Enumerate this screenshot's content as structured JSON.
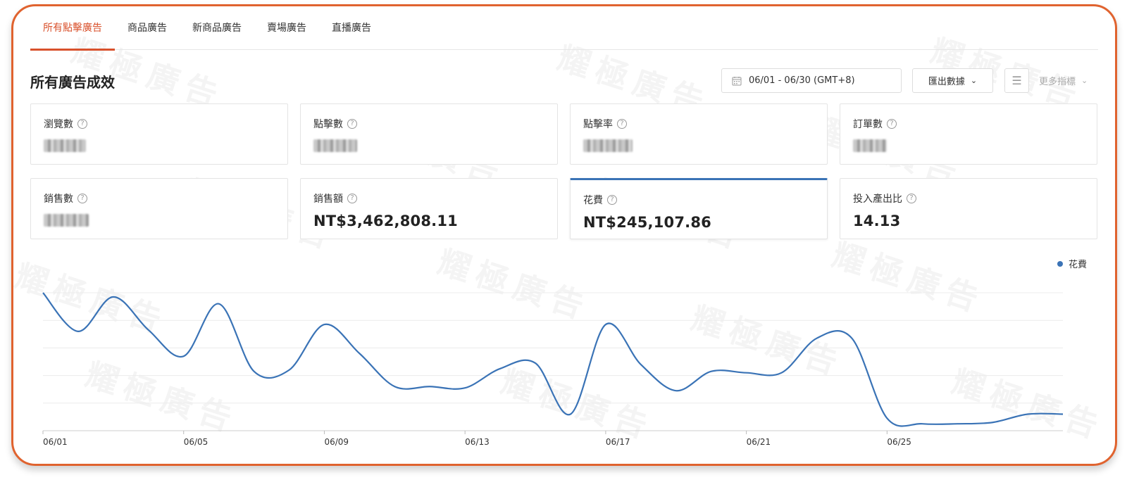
{
  "tabs": [
    {
      "label": "所有點擊廣告",
      "active": true
    },
    {
      "label": "商品廣告",
      "active": false
    },
    {
      "label": "新商品廣告",
      "active": false
    },
    {
      "label": "賣場廣告",
      "active": false
    },
    {
      "label": "直播廣告",
      "active": false
    }
  ],
  "section_title": "所有廣告成效",
  "toolbar": {
    "date_range": "06/01 - 06/30 (GMT+8)",
    "export_label": "匯出數據",
    "more_metrics_label": "更多指標"
  },
  "metrics": [
    {
      "label": "瀏覽數",
      "value": "",
      "hidden": true
    },
    {
      "label": "點擊數",
      "value": "",
      "hidden": true
    },
    {
      "label": "點擊率",
      "value": "",
      "hidden": true
    },
    {
      "label": "訂單數",
      "value": "",
      "hidden": true
    },
    {
      "label": "銷售數",
      "value": "",
      "hidden": true
    },
    {
      "label": "銷售額",
      "value": "NT$3,462,808.11",
      "hidden": false
    },
    {
      "label": "花費",
      "value": "NT$245,107.86",
      "hidden": false,
      "selected": true
    },
    {
      "label": "投入產出比",
      "value": "14.13",
      "hidden": false
    }
  ],
  "watermark_text": "耀極廣告",
  "colors": {
    "accent": "#d9512c",
    "frame": "#e0632f",
    "series": "#3a73b6"
  },
  "chart_data": {
    "type": "line",
    "legend": [
      "花費"
    ],
    "legend_position": "top-right",
    "grid": true,
    "x": [
      "06/01",
      "06/02",
      "06/03",
      "06/04",
      "06/05",
      "06/06",
      "06/07",
      "06/08",
      "06/09",
      "06/10",
      "06/11",
      "06/12",
      "06/13",
      "06/14",
      "06/15",
      "06/16",
      "06/17",
      "06/18",
      "06/19",
      "06/20",
      "06/21",
      "06/22",
      "06/23",
      "06/24",
      "06/25",
      "06/26",
      "06/27",
      "06/28",
      "06/29",
      "06/30"
    ],
    "x_ticks": [
      "06/01",
      "06/05",
      "06/09",
      "06/13",
      "06/17",
      "06/21",
      "06/25"
    ],
    "series": [
      {
        "name": "花費",
        "values": [
          100,
          72,
          97,
          73,
          54,
          92,
          43,
          44,
          77,
          56,
          32,
          32,
          31,
          45,
          49,
          12,
          77,
          48,
          29,
          43,
          42,
          42,
          67,
          67,
          9,
          5,
          5,
          6,
          12,
          12
        ]
      }
    ],
    "ylim": [
      0,
      100
    ]
  }
}
